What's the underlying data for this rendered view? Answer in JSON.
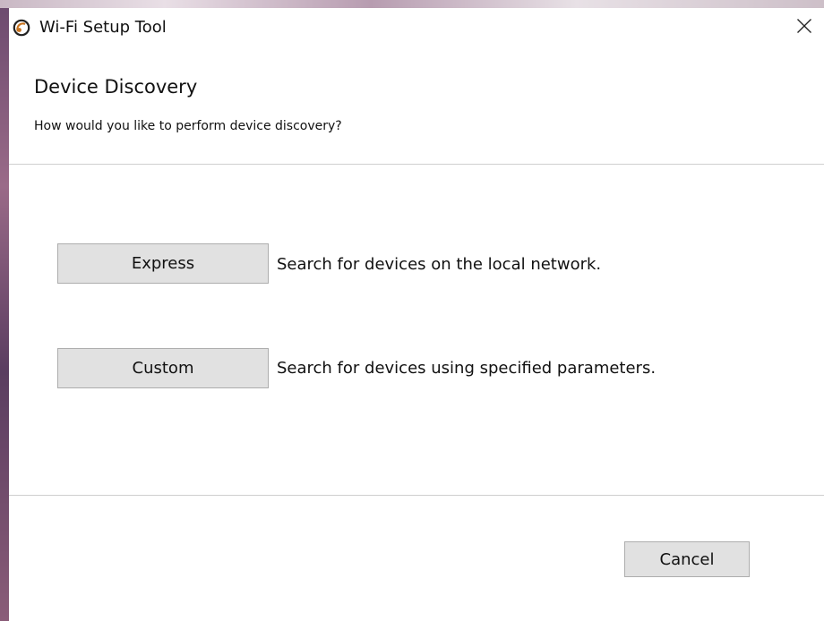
{
  "window": {
    "title": "Wi-Fi Setup Tool",
    "app_icon": "wifi-setup-app-icon",
    "close_icon": "close-icon"
  },
  "page": {
    "heading": "Device Discovery",
    "subheading": "How would you like to perform device discovery?"
  },
  "options": [
    {
      "button_label": "Express",
      "description": "Search for devices on the local network."
    },
    {
      "button_label": "Custom",
      "description": "Search for devices using specified parameters."
    }
  ],
  "footer": {
    "cancel_label": "Cancel"
  },
  "colors": {
    "button_bg": "#e1e1e1",
    "button_border": "#adadad",
    "divider": "#cfcfcf",
    "window_bg": "#ffffff"
  }
}
